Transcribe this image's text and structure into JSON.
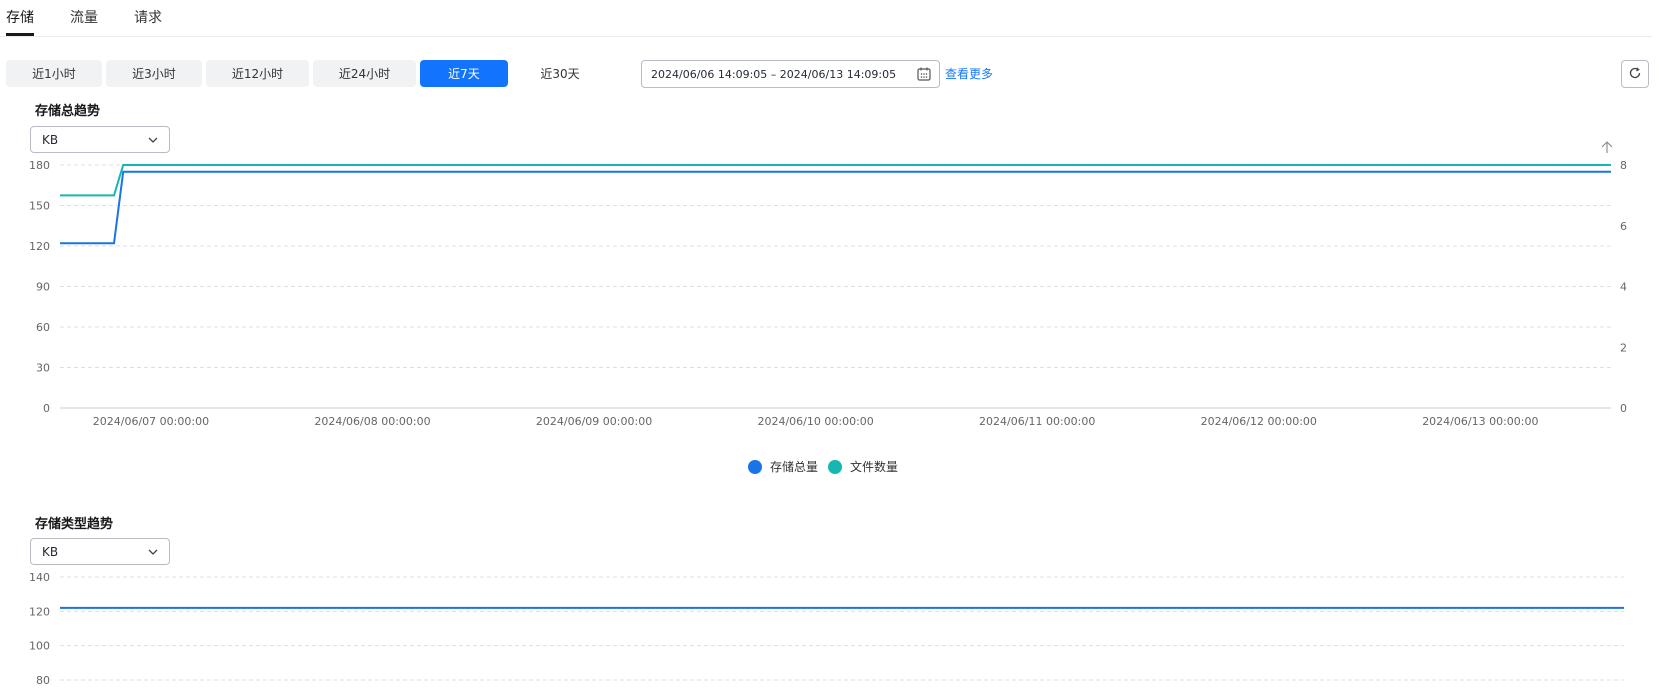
{
  "tabs": [
    {
      "label": "存储",
      "active": true
    },
    {
      "label": "流量",
      "active": false
    },
    {
      "label": "请求",
      "active": false
    }
  ],
  "time_ranges": [
    {
      "label": "近1小时",
      "active": false
    },
    {
      "label": "近3小时",
      "active": false
    },
    {
      "label": "近12小时",
      "active": false
    },
    {
      "label": "近24小时",
      "active": false
    },
    {
      "label": "近7天",
      "active": true
    },
    {
      "label": "近30天",
      "active": false
    }
  ],
  "date_range": {
    "value": "2024/06/06 14:09:05 – 2024/06/13 14:09:05",
    "icon": "calendar-icon"
  },
  "more_link": "查看更多",
  "refresh_icon": "refresh-icon",
  "colors": {
    "accent": "#1273fd",
    "series_total": "#1a73e8",
    "series_count": "#14b8b0",
    "grid": "#dcdfe8"
  },
  "chart_data": [
    {
      "type": "line",
      "title": "存储总趋势",
      "unit_select": "KB",
      "x_labels": [
        "2024/06/07 00:00:00",
        "2024/06/08 00:00:00",
        "2024/06/09 00:00:00",
        "2024/06/10 00:00:00",
        "2024/06/11 00:00:00",
        "2024/06/12 00:00:00",
        "2024/06/13 00:00:00"
      ],
      "x_range": [
        "2024/06/06 14:09:05",
        "2024/06/13 14:09:05"
      ],
      "y_left_ticks": [
        0,
        30,
        60,
        90,
        120,
        150,
        180
      ],
      "y_left_range": [
        0,
        180
      ],
      "y_right_ticks": [
        0,
        2,
        4,
        6,
        8
      ],
      "y_right_range": [
        0,
        8
      ],
      "grid": true,
      "legend_position": "bottom-center",
      "series": [
        {
          "name": "存储总量",
          "axis": "left",
          "color": "#1a73e8",
          "points": [
            [
              "2024/06/06 14:09:05",
              122
            ],
            [
              "2024/06/06 20:00:00",
              122
            ],
            [
              "2024/06/06 21:00:00",
              175
            ],
            [
              "2024/06/13 14:09:05",
              175
            ]
          ]
        },
        {
          "name": "文件数量",
          "axis": "right",
          "color": "#14b8b0",
          "points": [
            [
              "2024/06/06 14:09:05",
              7
            ],
            [
              "2024/06/06 20:00:00",
              7
            ],
            [
              "2024/06/06 21:00:00",
              8
            ],
            [
              "2024/06/13 14:09:05",
              8
            ]
          ]
        }
      ]
    },
    {
      "type": "line",
      "title": "存储类型趋势",
      "unit_select": "KB",
      "y_left_ticks": [
        80,
        100,
        120,
        140
      ],
      "y_left_range": [
        80,
        140
      ],
      "grid": true,
      "series": [
        {
          "color": "#1a73e8",
          "points": [
            [
              "2024/06/06 14:09:05",
              122
            ],
            [
              "2024/06/13 14:09:05",
              122
            ]
          ]
        }
      ]
    }
  ]
}
